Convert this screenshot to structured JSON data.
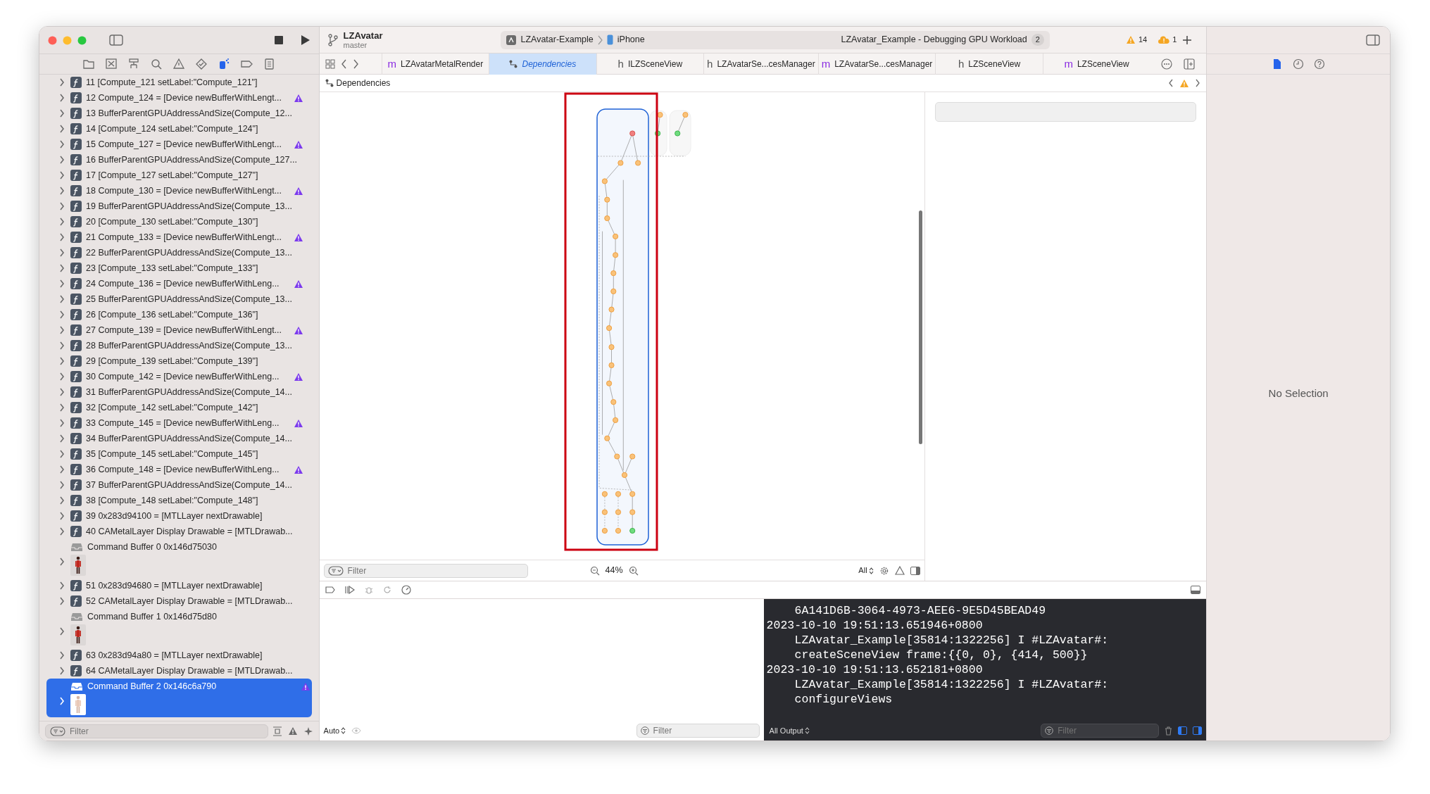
{
  "window": {
    "title": "LZAvatar",
    "branch": "master"
  },
  "scheme": {
    "target": "LZAvatar-Example",
    "device": "iPhone"
  },
  "activity": {
    "status": "LZAvatar_Example - Debugging GPU Workload",
    "count": "2",
    "warnings": "14",
    "issues": "1"
  },
  "navigator_tabs": [
    {
      "kind": "folder",
      "selected": false
    },
    {
      "kind": "source",
      "selected": false
    },
    {
      "kind": "symbols",
      "selected": false
    },
    {
      "kind": "search",
      "selected": false
    },
    {
      "kind": "issues",
      "selected": false
    },
    {
      "kind": "tests",
      "selected": false
    },
    {
      "kind": "debug",
      "selected": true
    },
    {
      "kind": "breakpoints",
      "selected": false
    },
    {
      "kind": "reports",
      "selected": false
    }
  ],
  "navigator": {
    "filter_placeholder": "Filter",
    "items": [
      {
        "kind": "call",
        "text": "11 [Compute_121 setLabel:\"Compute_121\"]",
        "warning": false,
        "expandable": true,
        "selected": false
      },
      {
        "kind": "call",
        "text": "12 Compute_124 = [Device newBufferWithLengt...",
        "warning": true,
        "expandable": true,
        "selected": false
      },
      {
        "kind": "call",
        "text": "13 BufferParentGPUAddressAndSize(Compute_12...",
        "warning": false,
        "expandable": true,
        "selected": false
      },
      {
        "kind": "call",
        "text": "14 [Compute_124 setLabel:\"Compute_124\"]",
        "warning": false,
        "expandable": true,
        "selected": false
      },
      {
        "kind": "call",
        "text": "15 Compute_127 = [Device newBufferWithLengt...",
        "warning": true,
        "expandable": true,
        "selected": false
      },
      {
        "kind": "call",
        "text": "16 BufferParentGPUAddressAndSize(Compute_127...",
        "warning": false,
        "expandable": true,
        "selected": false
      },
      {
        "kind": "call",
        "text": "17 [Compute_127 setLabel:\"Compute_127\"]",
        "warning": false,
        "expandable": true,
        "selected": false
      },
      {
        "kind": "call",
        "text": "18 Compute_130 = [Device newBufferWithLengt...",
        "warning": true,
        "expandable": true,
        "selected": false
      },
      {
        "kind": "call",
        "text": "19 BufferParentGPUAddressAndSize(Compute_13...",
        "warning": false,
        "expandable": true,
        "selected": false
      },
      {
        "kind": "call",
        "text": "20 [Compute_130 setLabel:\"Compute_130\"]",
        "warning": false,
        "expandable": true,
        "selected": false
      },
      {
        "kind": "call",
        "text": "21 Compute_133 = [Device newBufferWithLengt...",
        "warning": true,
        "expandable": true,
        "selected": false
      },
      {
        "kind": "call",
        "text": "22 BufferParentGPUAddressAndSize(Compute_13...",
        "warning": false,
        "expandable": true,
        "selected": false
      },
      {
        "kind": "call",
        "text": "23 [Compute_133 setLabel:\"Compute_133\"]",
        "warning": false,
        "expandable": true,
        "selected": false
      },
      {
        "kind": "call",
        "text": "24 Compute_136 = [Device newBufferWithLeng...",
        "warning": true,
        "expandable": true,
        "selected": false
      },
      {
        "kind": "call",
        "text": "25 BufferParentGPUAddressAndSize(Compute_13...",
        "warning": false,
        "expandable": true,
        "selected": false
      },
      {
        "kind": "call",
        "text": "26 [Compute_136 setLabel:\"Compute_136\"]",
        "warning": false,
        "expandable": true,
        "selected": false
      },
      {
        "kind": "call",
        "text": "27 Compute_139 = [Device newBufferWithLengt...",
        "warning": true,
        "expandable": true,
        "selected": false
      },
      {
        "kind": "call",
        "text": "28 BufferParentGPUAddressAndSize(Compute_13...",
        "warning": false,
        "expandable": true,
        "selected": false
      },
      {
        "kind": "call",
        "text": "29 [Compute_139 setLabel:\"Compute_139\"]",
        "warning": false,
        "expandable": true,
        "selected": false
      },
      {
        "kind": "call",
        "text": "30 Compute_142 = [Device newBufferWithLeng...",
        "warning": true,
        "expandable": true,
        "selected": false
      },
      {
        "kind": "call",
        "text": "31 BufferParentGPUAddressAndSize(Compute_14...",
        "warning": false,
        "expandable": true,
        "selected": false
      },
      {
        "kind": "call",
        "text": "32 [Compute_142 setLabel:\"Compute_142\"]",
        "warning": false,
        "expandable": true,
        "selected": false
      },
      {
        "kind": "call",
        "text": "33 Compute_145 = [Device newBufferWithLeng...",
        "warning": true,
        "expandable": true,
        "selected": false
      },
      {
        "kind": "call",
        "text": "34 BufferParentGPUAddressAndSize(Compute_14...",
        "warning": false,
        "expandable": true,
        "selected": false
      },
      {
        "kind": "call",
        "text": "35 [Compute_145 setLabel:\"Compute_145\"]",
        "warning": false,
        "expandable": true,
        "selected": false
      },
      {
        "kind": "call",
        "text": "36 Compute_148 = [Device newBufferWithLeng...",
        "warning": true,
        "expandable": true,
        "selected": false
      },
      {
        "kind": "call",
        "text": "37 BufferParentGPUAddressAndSize(Compute_14...",
        "warning": false,
        "expandable": true,
        "selected": false
      },
      {
        "kind": "call",
        "text": "38 [Compute_148 setLabel:\"Compute_148\"]",
        "warning": false,
        "expandable": true,
        "selected": false
      },
      {
        "kind": "call",
        "text": "39 0x283d94100 = [MTLLayer nextDrawable]",
        "warning": false,
        "expandable": true,
        "selected": false
      },
      {
        "kind": "call",
        "text": "40 CAMetalLayer Display Drawable = [MTLDrawab...",
        "warning": false,
        "expandable": true,
        "selected": false
      },
      {
        "kind": "buffer",
        "text": "Command Buffer 0 0x146d75030",
        "warning": false,
        "expandable": false,
        "selected": false
      },
      {
        "kind": "thumbnail",
        "warning": false,
        "expandable": true,
        "selected": false
      },
      {
        "kind": "call",
        "text": "51 0x283d94680 = [MTLLayer nextDrawable]",
        "warning": false,
        "expandable": true,
        "selected": false
      },
      {
        "kind": "call",
        "text": "52 CAMetalLayer Display Drawable = [MTLDrawab...",
        "warning": false,
        "expandable": true,
        "selected": false
      },
      {
        "kind": "buffer",
        "text": "Command Buffer 1 0x146d75d80",
        "warning": false,
        "expandable": false,
        "selected": false
      },
      {
        "kind": "thumbnail",
        "warning": false,
        "expandable": true,
        "selected": false
      },
      {
        "kind": "call",
        "text": "63 0x283d94a80 = [MTLLayer nextDrawable]",
        "warning": false,
        "expandable": true,
        "selected": false
      },
      {
        "kind": "call",
        "text": "64 CAMetalLayer Display Drawable = [MTLDrawab...",
        "warning": false,
        "expandable": true,
        "selected": false
      },
      {
        "kind": "buffer",
        "text": "Command Buffer 2 0x146c6a790",
        "warning": true,
        "expandable": false,
        "selected": true
      },
      {
        "kind": "thumbnail",
        "warning": false,
        "expandable": true,
        "selected": true
      }
    ]
  },
  "tabs": [
    {
      "kind": "source",
      "icon_letter": "m",
      "label": "LZAvatarMetalRender",
      "selected": false
    },
    {
      "kind": "graph",
      "label": "Dependencies",
      "selected": true
    },
    {
      "kind": "header",
      "icon_letter": "h",
      "label": "ILZSceneView",
      "selected": false
    },
    {
      "kind": "header",
      "icon_letter": "h",
      "label": "LZAvatarSe...cesManager",
      "selected": false
    },
    {
      "kind": "source",
      "icon_letter": "m",
      "label": "LZAvatarSe...cesManager",
      "selected": false
    },
    {
      "kind": "header",
      "icon_letter": "h",
      "label": "LZSceneView",
      "selected": false
    },
    {
      "kind": "source",
      "icon_letter": "m",
      "label": "LZSceneView",
      "selected": false
    }
  ],
  "jump_bar": {
    "label": "Dependencies"
  },
  "graph": {
    "filter_placeholder": "Filter",
    "zoom": "44%",
    "scope": "All"
  },
  "variables": {
    "mode": "Auto",
    "filter_placeholder": "Filter"
  },
  "console": {
    "lines": [
      {
        "text": "6A141D6B-3064-4973-AEE6-9E5D45BEAD49",
        "indent": true
      },
      {
        "text": "2023-10-10 19:51:13.651946+0800",
        "indent": false
      },
      {
        "text": "LZAvatar_Example[35814:1322256] I #LZAvatar#:",
        "indent": true
      },
      {
        "text": "createSceneView frame:{{0, 0}, {414, 500}}",
        "indent": true
      },
      {
        "text": "2023-10-10 19:51:13.652181+0800",
        "indent": false
      },
      {
        "text": "LZAvatar_Example[35814:1322256] I #LZAvatar#:",
        "indent": true
      },
      {
        "text": "configureViews",
        "indent": true
      }
    ],
    "output": "All Output",
    "filter_placeholder": "Filter"
  },
  "inspector": {
    "tabs": [
      {
        "kind": "file",
        "selected": true
      },
      {
        "kind": "history",
        "selected": false
      },
      {
        "kind": "help",
        "selected": false
      }
    ],
    "message": "No Selection"
  }
}
